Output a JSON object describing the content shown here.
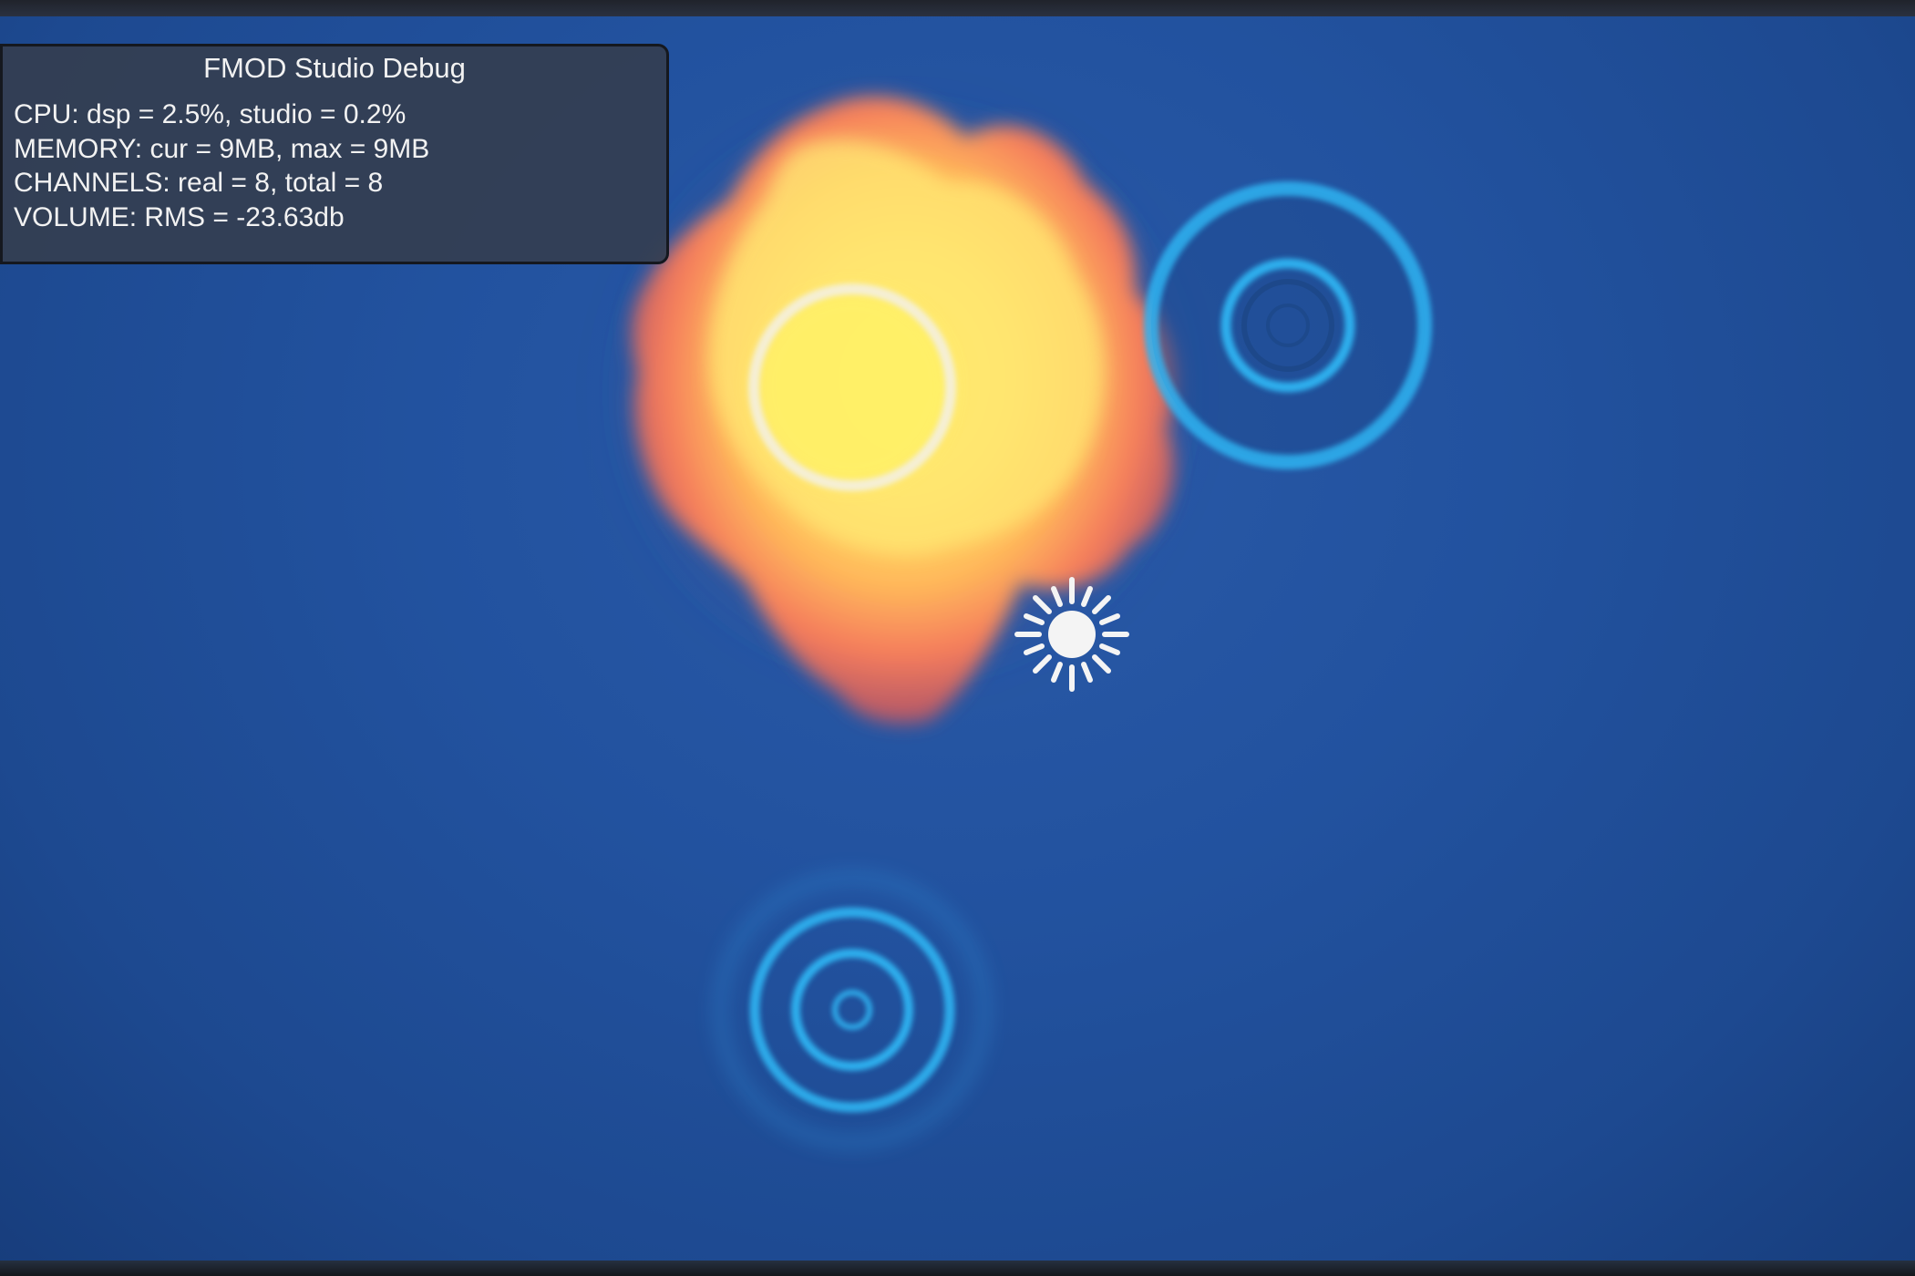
{
  "debug_panel": {
    "title": "FMOD Studio Debug",
    "lines": [
      "CPU: dsp = 2.5%, studio = 0.2%",
      "MEMORY: cur = 9MB, max = 9MB",
      "CHANNELS: real = 8, total = 8",
      "VOLUME: RMS = -23.63db"
    ]
  },
  "scene": {
    "background_color": "#22529f",
    "ring_color": "#2fb4f2",
    "fire_colors": [
      "#fff35a",
      "#ffd05a",
      "#ff9a52",
      "#e8645a"
    ],
    "icons": [
      "fire-emitter-icon",
      "sound-emitter-ring-icon",
      "listener-sun-icon"
    ]
  }
}
